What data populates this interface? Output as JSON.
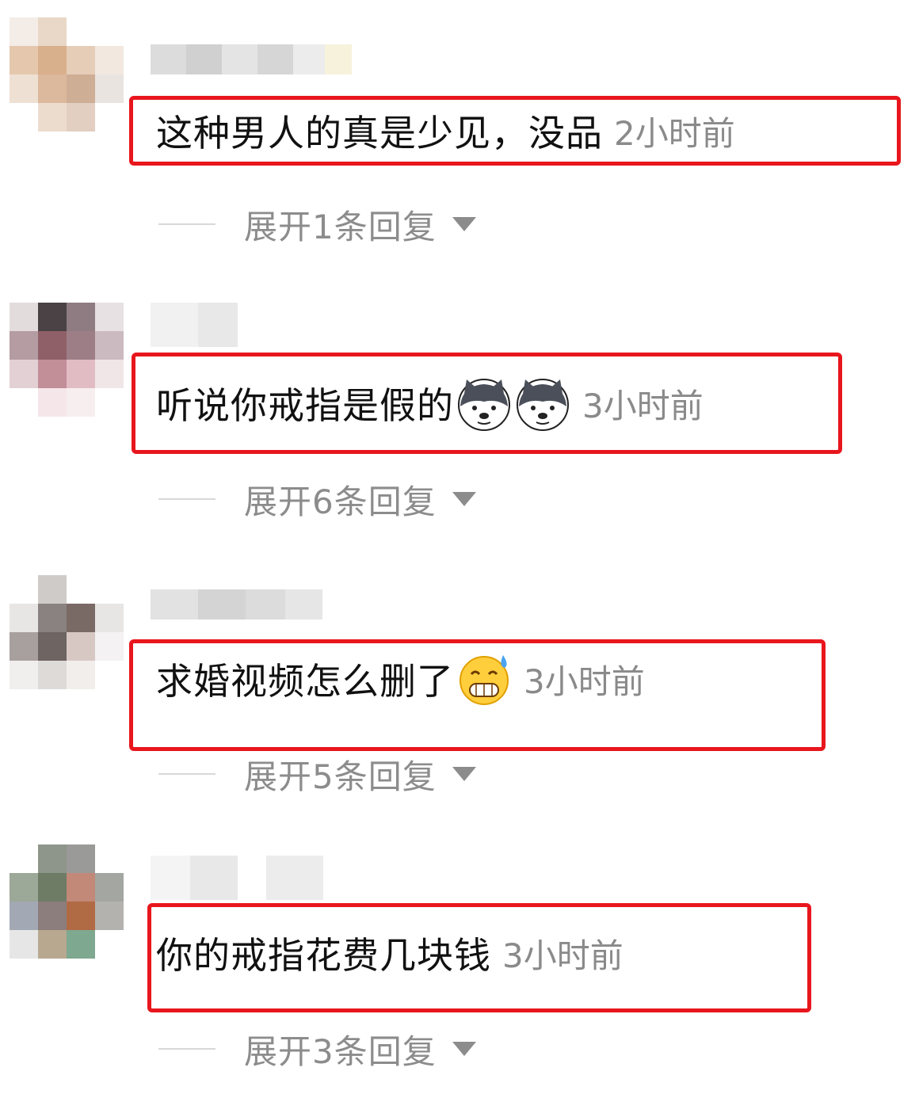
{
  "comments": [
    {
      "text": "这种男人的真是少见，没品",
      "time": "2小时前",
      "emojis": [],
      "expand_label": "展开1条回复"
    },
    {
      "text": "听说你戒指是假的",
      "time": "3小时前",
      "emojis": [
        "dog-face-emoji",
        "dog-face-emoji"
      ],
      "expand_label": "展开6条回复"
    },
    {
      "text": "求婚视频怎么删了",
      "time": "3小时前",
      "emojis": [
        "sweat-grin-emoji"
      ],
      "expand_label": "展开5条回复"
    },
    {
      "text": "你的戒指花费几块钱",
      "time": "3小时前",
      "emojis": [],
      "expand_label": "展开3条回复"
    }
  ],
  "colors": {
    "highlight_border": "#e8161d",
    "comment_text": "#111111",
    "muted_text": "#8c8c8c",
    "background": "#ffffff"
  }
}
